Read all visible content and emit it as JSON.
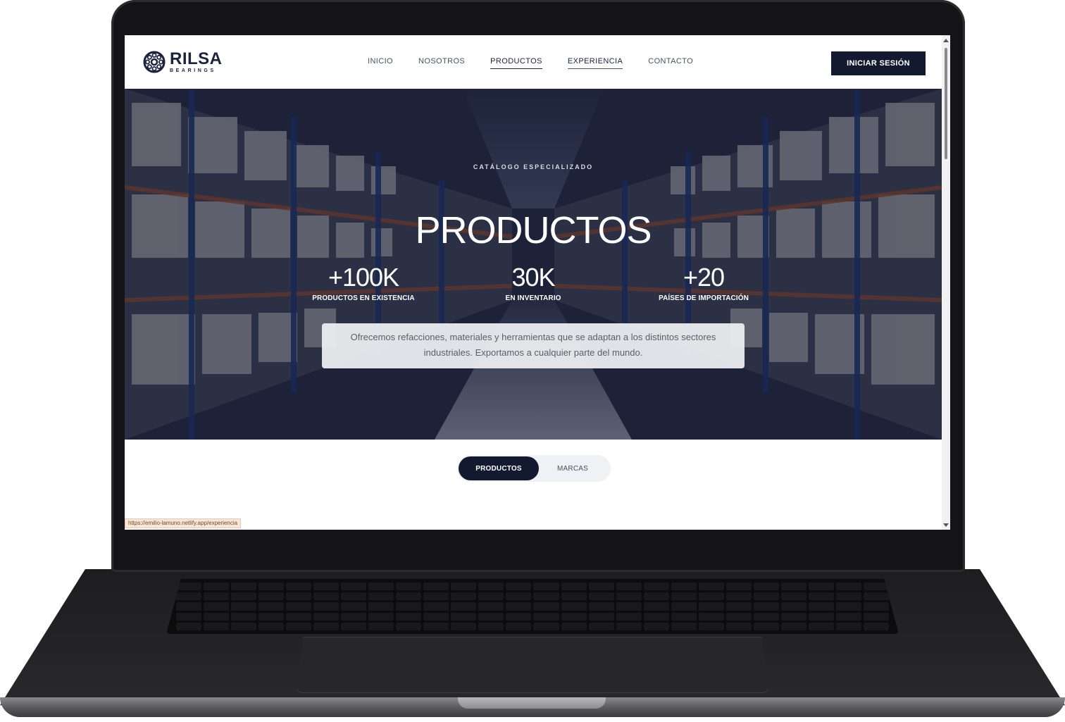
{
  "brand": {
    "name": "RILSA",
    "subtitle": "BEARINGS"
  },
  "nav": {
    "links": [
      {
        "label": "INICIO"
      },
      {
        "label": "NOSOTROS"
      },
      {
        "label": "PRODUCTOS"
      },
      {
        "label": "EXPERIENCIA"
      },
      {
        "label": "CONTACTO"
      }
    ],
    "active": "PRODUCTOS",
    "login_label": "INICIAR SESIÓN"
  },
  "hero": {
    "eyebrow": "CATÁLOGO ESPECIALIZADO",
    "title": "PRODUCTOS",
    "stats": [
      {
        "value": "+100K",
        "label": "PRODUCTOS EN EXISTENCIA"
      },
      {
        "value": "30K",
        "label": "EN INVENTARIO"
      },
      {
        "value": "+20",
        "label": "PAÍSES DE IMPORTACIÓN"
      }
    ],
    "description": "Ofrecemos refacciones, materiales y herramientas que se adaptan a los distintos sectores industriales. Exportamos a cualquier parte del mundo."
  },
  "tabs": {
    "items": [
      {
        "label": "PRODUCTOS"
      },
      {
        "label": "MARCAS"
      }
    ],
    "active": "PRODUCTOS"
  },
  "status_bar": {
    "url": "https://emilio-lamuno.netlify.app/experiencia"
  },
  "colors": {
    "navy": "#131a30",
    "brand_text": "#1b2340",
    "hero_overlay": "#121830",
    "tab_bg": "#f0f1f4"
  },
  "icons": [
    "bearing-logo-icon",
    "scroll-up-icon",
    "scroll-down-icon"
  ]
}
